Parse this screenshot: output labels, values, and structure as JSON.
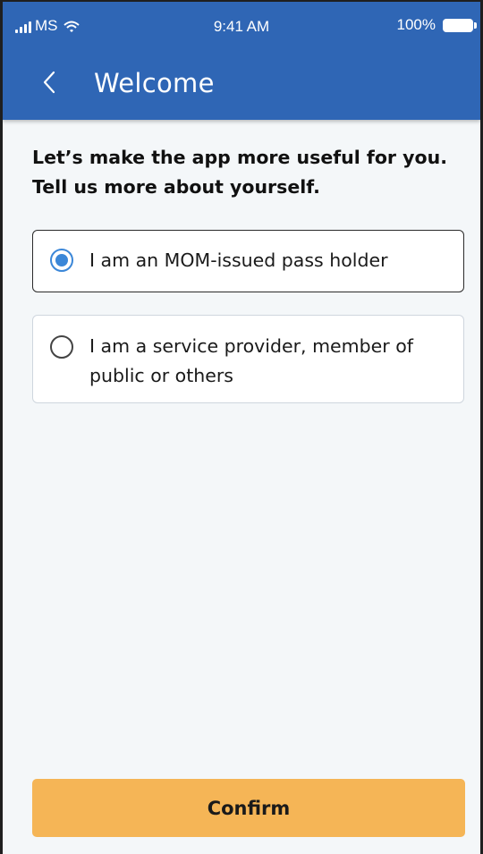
{
  "status_bar": {
    "carrier": "MS",
    "time": "9:41 AM",
    "battery_percent": "100%"
  },
  "header": {
    "title": "Welcome"
  },
  "intro": {
    "line1": "Let’s make the app more useful for you.",
    "line2": "Tell us more about yourself."
  },
  "options": [
    {
      "label": "I am an MOM-issued pass holder",
      "selected": true
    },
    {
      "label": "I am a service provider, member of public or others",
      "selected": false
    }
  ],
  "confirm_label": "Confirm",
  "colors": {
    "header_bg": "#2f66b5",
    "accent_radio": "#3b87d8",
    "confirm_bg": "#f5b556",
    "page_bg": "#f4f7f9"
  }
}
